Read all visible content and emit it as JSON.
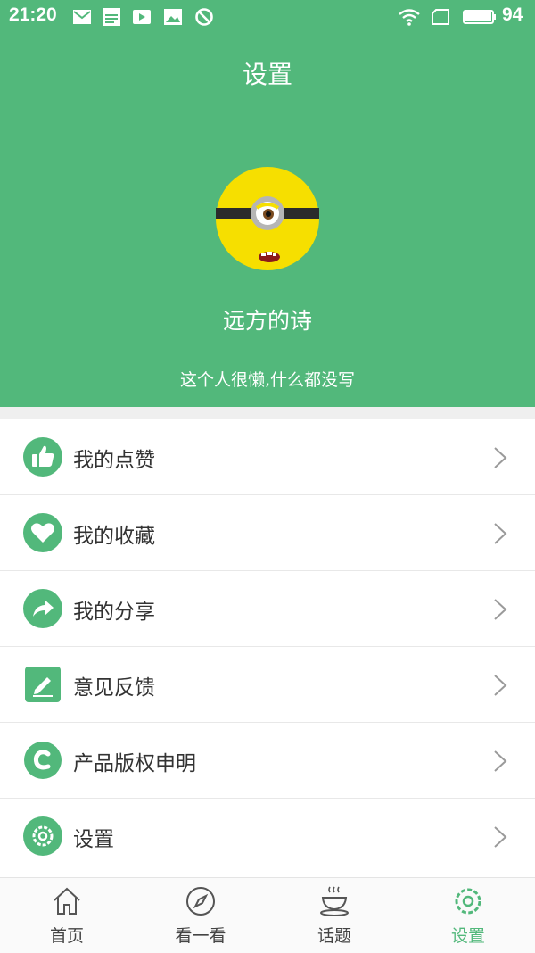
{
  "status_bar": {
    "time": "21:20",
    "battery": "94"
  },
  "header": {
    "title": "设置",
    "username": "远方的诗",
    "bio": "这个人很懒,什么都没写"
  },
  "menu": [
    {
      "label": "我的点赞",
      "icon": "thumbs-up-icon"
    },
    {
      "label": "我的收藏",
      "icon": "heart-icon"
    },
    {
      "label": "我的分享",
      "icon": "share-arrow-icon"
    },
    {
      "label": "意见反馈",
      "icon": "edit-feedback-icon"
    },
    {
      "label": "产品版权申明",
      "icon": "copyright-c-icon"
    },
    {
      "label": "设置",
      "icon": "gear-icon"
    }
  ],
  "tabs": [
    {
      "label": "首页",
      "icon": "home-icon",
      "active": false
    },
    {
      "label": "看一看",
      "icon": "compass-icon",
      "active": false
    },
    {
      "label": "话题",
      "icon": "coffee-cup-icon",
      "active": false
    },
    {
      "label": "设置",
      "icon": "gear-icon",
      "active": true
    }
  ],
  "colors": {
    "accent": "#52b87b",
    "text": "#333333",
    "tab_text": "#444444",
    "avatar_yellow": "#f6df00"
  }
}
